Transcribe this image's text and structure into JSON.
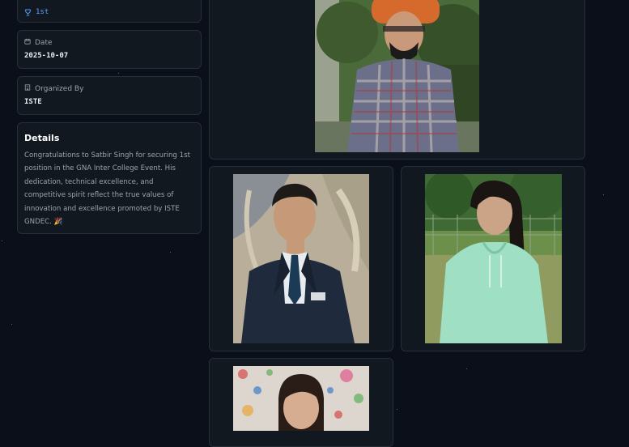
{
  "result_card": {
    "value": "1st",
    "icon": "trophy-icon"
  },
  "date_card": {
    "label": "Date",
    "value": "2025-10-07",
    "icon": "calendar-icon"
  },
  "organizer_card": {
    "label": "Organized By",
    "value": "ISTE",
    "icon": "building-icon"
  },
  "details": {
    "title": "Details",
    "text": "Congratulations to Satbir Singh for securing 1st position in the GNA Inter College Event. His dedication, technical excellence, and competitive spirit reflect the true values of innovation and excellence promoted by ISTE GNDEC. 🎉"
  },
  "gallery": {
    "photos": [
      "participant-photo-turban",
      "participant-photo-suit",
      "participant-photo-green-hoodie",
      "participant-photo-colorful-wall"
    ]
  },
  "colors": {
    "background": "#0a0f1a",
    "card": "#111820",
    "border": "#262e38",
    "accent": "#58a6ff"
  }
}
